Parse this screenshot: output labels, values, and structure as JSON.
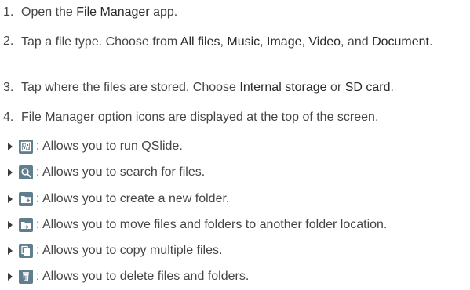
{
  "steps": [
    {
      "num": "1.",
      "parts": [
        "Open the ",
        "File Manager",
        " app."
      ]
    },
    {
      "num": "2.",
      "parts": [
        "Tap a file type. Choose from ",
        "All files",
        ", ",
        "Music",
        ", ",
        "Image",
        ", ",
        "Video",
        ", and ",
        "Document",
        "."
      ]
    },
    {
      "num": "3.",
      "parts": [
        "Tap where the files are stored. Choose ",
        "Internal storage",
        " or ",
        "SD card",
        "."
      ]
    },
    {
      "num": "4.",
      "parts": [
        "File Manager option icons are displayed at the top of the screen."
      ]
    }
  ],
  "options": [
    {
      "icon": "qslide-icon",
      "text": ": Allows you to run QSlide."
    },
    {
      "icon": "search-icon",
      "text": ": Allows you to search for files."
    },
    {
      "icon": "new-folder-icon",
      "text": ": Allows you to create a new folder."
    },
    {
      "icon": "move-folder-icon",
      "text": ": Allows you to move files and folders to another folder location."
    },
    {
      "icon": "copy-icon",
      "text": ": Allows you to copy multiple files."
    },
    {
      "icon": "delete-icon",
      "text": ": Allows you to delete files and folders."
    }
  ],
  "colors": {
    "text": "#454545",
    "icon_bg": "#5f7e8e"
  }
}
